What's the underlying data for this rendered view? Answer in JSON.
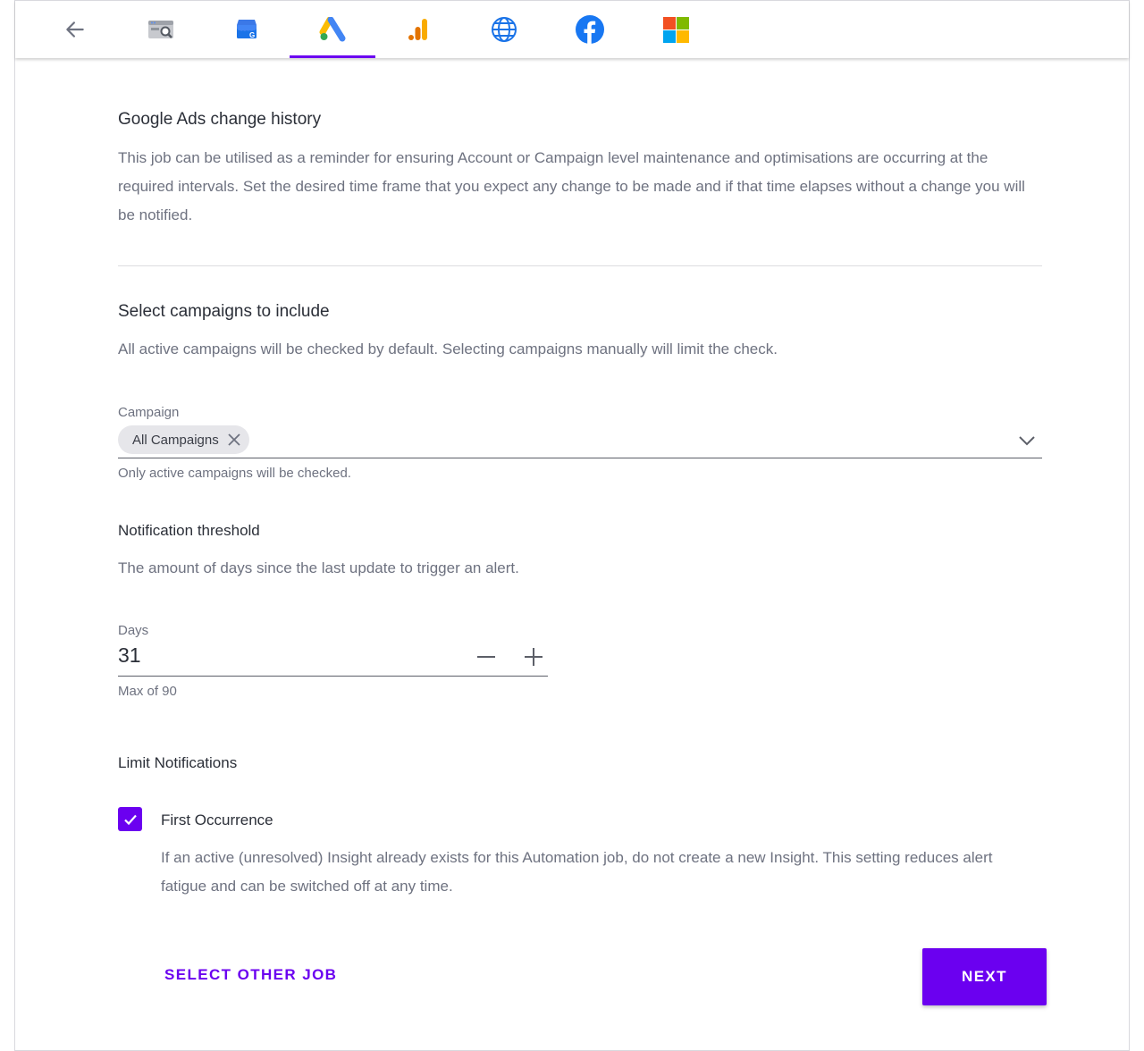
{
  "nav": {
    "tabs": [
      {
        "name": "back",
        "icon": "back-arrow-icon"
      },
      {
        "name": "search-console",
        "icon": "search-console-icon"
      },
      {
        "name": "google-business-profile",
        "icon": "google-business-profile-icon"
      },
      {
        "name": "google-ads",
        "icon": "google-ads-icon",
        "active": true
      },
      {
        "name": "google-analytics",
        "icon": "google-analytics-icon"
      },
      {
        "name": "website",
        "icon": "globe-icon"
      },
      {
        "name": "facebook",
        "icon": "facebook-icon"
      },
      {
        "name": "microsoft",
        "icon": "microsoft-icon"
      }
    ],
    "active_color": "#6b00f0"
  },
  "job": {
    "title": "Google Ads change history",
    "description": "This job can be utilised as a reminder for ensuring Account or Campaign level maintenance and optimisations are occurring at the required intervals. Set the desired time frame that you expect any change to be made and if that time elapses without a change you will be notified."
  },
  "campaigns": {
    "heading": "Select campaigns to include",
    "description": "All active campaigns will be checked by default. Selecting campaigns manually will limit the check.",
    "field_label": "Campaign",
    "selected_chip": "All Campaigns",
    "helper": "Only active campaigns will be checked."
  },
  "threshold": {
    "heading": "Notification threshold",
    "description": "The amount of days since the last update to trigger an alert.",
    "field_label": "Days",
    "value": "31",
    "helper": "Max of 90"
  },
  "limit": {
    "heading": "Limit Notifications",
    "checkbox_label": "First Occurrence",
    "checked": true,
    "description": "If an active (unresolved) Insight already exists for this Automation job, do not create a new Insight. This setting reduces alert fatigue and can be switched off at any time."
  },
  "actions": {
    "secondary": "SELECT OTHER JOB",
    "primary": "NEXT"
  }
}
